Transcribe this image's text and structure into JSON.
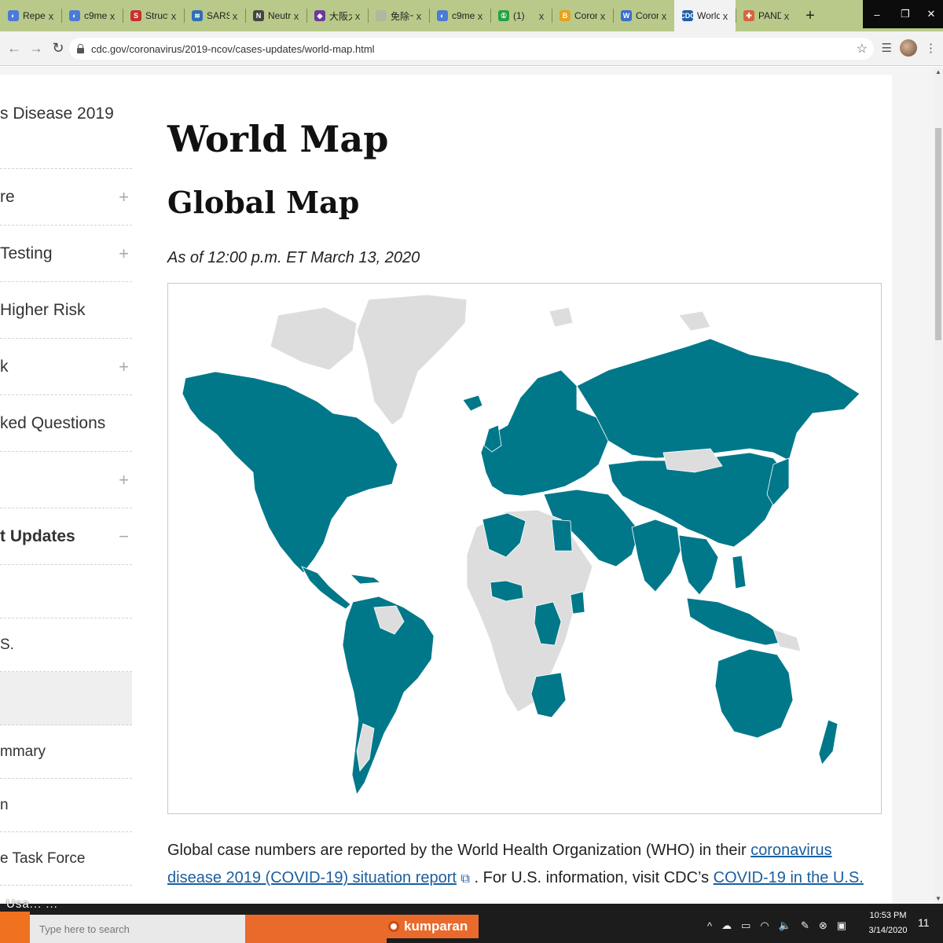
{
  "browser": {
    "tabs": [
      {
        "title": "Reper",
        "fav_color": "#4a7bd8",
        "fav_glyph": "◐"
      },
      {
        "title": "c9me(",
        "fav_color": "#4a7bd8",
        "fav_glyph": "◐"
      },
      {
        "title": "Struct",
        "fav_color": "#c9302c",
        "fav_glyph": "S"
      },
      {
        "title": "SARS-",
        "fav_color": "#2f6fb5",
        "fav_glyph": "≋"
      },
      {
        "title": "Neutr",
        "fav_color": "#444444",
        "fav_glyph": "N"
      },
      {
        "title": "大阪大",
        "fav_color": "#6a3a9c",
        "fav_glyph": "◆"
      },
      {
        "title": "免除卡",
        "fav_color": "#b0b8a0",
        "fav_glyph": ""
      },
      {
        "title": "c9me(",
        "fav_color": "#4a7bd8",
        "fav_glyph": "◐"
      },
      {
        "title": "(1)",
        "fav_color": "#25a244",
        "fav_glyph": "①"
      },
      {
        "title": "Coron",
        "fav_color": "#e8a21c",
        "fav_glyph": "B"
      },
      {
        "title": "Coron",
        "fav_color": "#3a6fcf",
        "fav_glyph": "W"
      },
      {
        "title": "World",
        "fav_color": "#1f5fa8",
        "fav_glyph": "CDC"
      },
      {
        "title": "PAND",
        "fav_color": "#d8643a",
        "fav_glyph": "✚"
      }
    ],
    "active_tab_index": 11,
    "close_glyph": "x",
    "newtab_glyph": "+",
    "window_controls": {
      "minimize": "–",
      "maximize": "❐",
      "close": "✕"
    },
    "url": "cdc.gov/coronavirus/2019-ncov/cases-updates/world-map.html",
    "back_glyph": "←",
    "forward_glyph": "→",
    "reload_glyph": "↻",
    "bookmark_glyph": "☆",
    "menu_glyph": "⋮",
    "reading_list_glyph": "☰"
  },
  "sidebar": {
    "items": [
      {
        "label": "s Disease 2019",
        "toggle": ""
      },
      {
        "label": "re",
        "toggle": "+"
      },
      {
        "label": "Testing",
        "toggle": "+"
      },
      {
        "label": "Higher Risk",
        "toggle": ""
      },
      {
        "label": "k",
        "toggle": "+"
      },
      {
        "label": "ked Questions",
        "toggle": ""
      },
      {
        "label": "",
        "toggle": "+"
      },
      {
        "label": "t Updates",
        "toggle": "−"
      },
      {
        "label": "",
        "toggle": ""
      },
      {
        "label": "S.",
        "toggle": ""
      },
      {
        "label": "",
        "toggle": ""
      },
      {
        "label": "mmary",
        "toggle": ""
      },
      {
        "label": "n",
        "toggle": ""
      },
      {
        "label": "e Task Force",
        "toggle": ""
      }
    ]
  },
  "main": {
    "title": "World Map",
    "subtitle": "Global Map",
    "as_of": "As of 12:00 p.m. ET March 13, 2020",
    "map": {
      "affected_color": "#00788a",
      "unaffected_color": "#dddddd"
    },
    "description": {
      "part1": "Global case numbers are reported by the World Health Organization (WHO) in their ",
      "link1": "coronavirus disease 2019 (COVID-19) situation report",
      "ext_glyph": "⧉",
      "part2": " . For U.S. information, visit CDC’s ",
      "link2": "COVID-19 in the U.S."
    }
  },
  "taskbar": {
    "search_placeholder": "Type here to search",
    "kumparan": "kumparan",
    "tray_glyphs": [
      "^",
      "☁",
      "▭",
      "◠",
      "🔈",
      "✎",
      "⊗",
      "▣"
    ],
    "time": "10:53 PM",
    "date": "3/14/2020",
    "notifications": "11",
    "overlay": "Usa... ..."
  }
}
